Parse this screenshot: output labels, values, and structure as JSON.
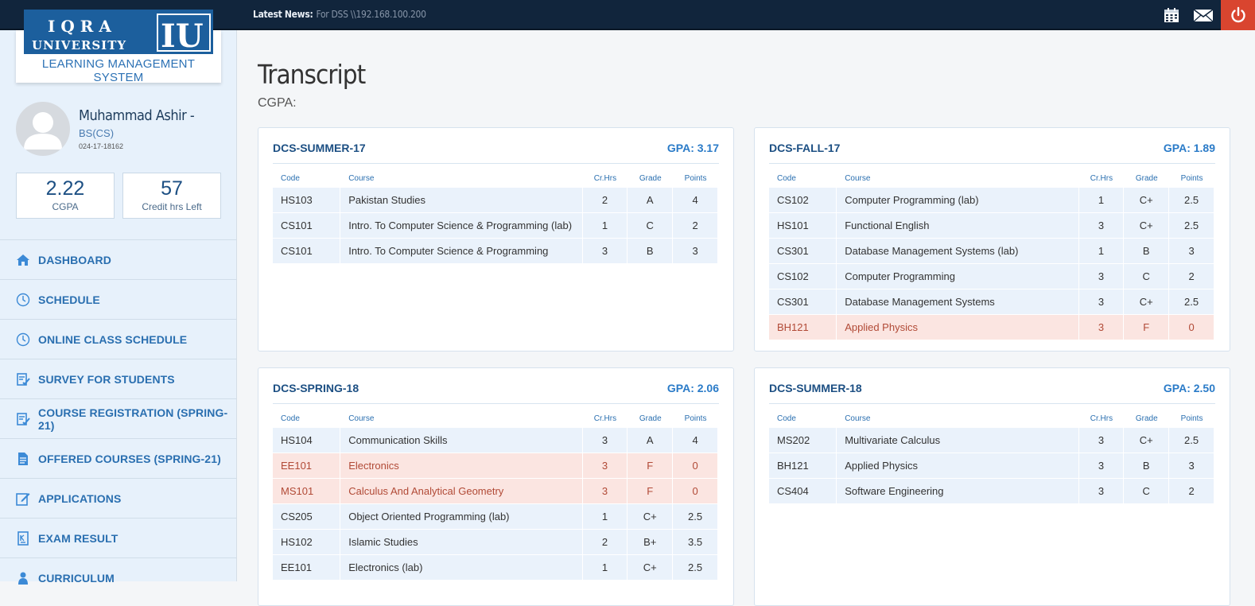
{
  "topbar": {
    "news_label": "Latest News:",
    "news_text": "For DSS \\\\192.168.100.200",
    "icons": [
      "calendar-icon",
      "mail-icon",
      "power-icon"
    ],
    "power_color": "#d9452f"
  },
  "logo": {
    "line1": "IQRA",
    "line2": "UNIVERSITY",
    "mark": "IU",
    "subtitle": "LEARNING MANAGEMENT SYSTEM",
    "brand_color": "#1c5f9d"
  },
  "profile": {
    "name": "Muhammad Ashir -",
    "program": "BS(CS)",
    "reg_no": "024-17-18162"
  },
  "stats": [
    {
      "value": "2.22",
      "label": "CGPA"
    },
    {
      "value": "57",
      "label": "Credit hrs Left"
    }
  ],
  "menu": [
    {
      "label": "DASHBOARD",
      "icon": "home-icon"
    },
    {
      "label": "SCHEDULE",
      "icon": "clock-icon"
    },
    {
      "label": "ONLINE CLASS SCHEDULE",
      "icon": "clock-icon"
    },
    {
      "label": "SURVEY FOR STUDENTS",
      "icon": "checklist-icon"
    },
    {
      "label": "COURSE REGISTRATION (SPRING-21)",
      "icon": "checklist-icon"
    },
    {
      "label": "OFFERED COURSES (SPRING-21)",
      "icon": "document-icon"
    },
    {
      "label": "APPLICATIONS",
      "icon": "edit-icon"
    },
    {
      "label": "EXAM RESULT",
      "icon": "result-icon"
    },
    {
      "label": "CURRICULUM",
      "icon": "person-icon"
    }
  ],
  "page": {
    "title": "Transcript",
    "cgpa_label": "CGPA:"
  },
  "table_headers": [
    "Code",
    "Course",
    "Cr.Hrs",
    "Grade",
    "Points"
  ],
  "semesters": [
    {
      "name": "DCS-SUMMER-17",
      "gpa": "GPA: 3.17",
      "rows": [
        {
          "code": "HS103",
          "course": "Pakistan Studies",
          "crhrs": "2",
          "grade": "A",
          "points": "4",
          "fail": false
        },
        {
          "code": "CS101",
          "course": "Intro. To Computer Science & Programming (lab)",
          "crhrs": "1",
          "grade": "C",
          "points": "2",
          "fail": false
        },
        {
          "code": "CS101",
          "course": "Intro. To Computer Science & Programming",
          "crhrs": "3",
          "grade": "B",
          "points": "3",
          "fail": false
        }
      ]
    },
    {
      "name": "DCS-FALL-17",
      "gpa": "GPA: 1.89",
      "rows": [
        {
          "code": "CS102",
          "course": "Computer Programming (lab)",
          "crhrs": "1",
          "grade": "C+",
          "points": "2.5",
          "fail": false
        },
        {
          "code": "HS101",
          "course": "Functional English",
          "crhrs": "3",
          "grade": "C+",
          "points": "2.5",
          "fail": false
        },
        {
          "code": "CS301",
          "course": "Database Management Systems (lab)",
          "crhrs": "1",
          "grade": "B",
          "points": "3",
          "fail": false
        },
        {
          "code": "CS102",
          "course": "Computer Programming",
          "crhrs": "3",
          "grade": "C",
          "points": "2",
          "fail": false
        },
        {
          "code": "CS301",
          "course": "Database Management Systems",
          "crhrs": "3",
          "grade": "C+",
          "points": "2.5",
          "fail": false
        },
        {
          "code": "BH121",
          "course": "Applied Physics",
          "crhrs": "3",
          "grade": "F",
          "points": "0",
          "fail": true
        }
      ]
    },
    {
      "name": "DCS-SPRING-18",
      "gpa": "GPA: 2.06",
      "rows": [
        {
          "code": "HS104",
          "course": "Communication Skills",
          "crhrs": "3",
          "grade": "A",
          "points": "4",
          "fail": false
        },
        {
          "code": "EE101",
          "course": "Electronics",
          "crhrs": "3",
          "grade": "F",
          "points": "0",
          "fail": true
        },
        {
          "code": "MS101",
          "course": "Calculus And Analytical Geometry",
          "crhrs": "3",
          "grade": "F",
          "points": "0",
          "fail": true
        },
        {
          "code": "CS205",
          "course": "Object Oriented Programming (lab)",
          "crhrs": "1",
          "grade": "C+",
          "points": "2.5",
          "fail": false
        },
        {
          "code": "HS102",
          "course": "Islamic Studies",
          "crhrs": "2",
          "grade": "B+",
          "points": "3.5",
          "fail": false
        },
        {
          "code": "EE101",
          "course": "Electronics (lab)",
          "crhrs": "1",
          "grade": "C+",
          "points": "2.5",
          "fail": false
        }
      ]
    },
    {
      "name": "DCS-SUMMER-18",
      "gpa": "GPA: 2.50",
      "rows": [
        {
          "code": "MS202",
          "course": "Multivariate Calculus",
          "crhrs": "3",
          "grade": "C+",
          "points": "2.5",
          "fail": false
        },
        {
          "code": "BH121",
          "course": "Applied Physics",
          "crhrs": "3",
          "grade": "B",
          "points": "3",
          "fail": false
        },
        {
          "code": "CS404",
          "course": "Software Engineering",
          "crhrs": "3",
          "grade": "C",
          "points": "2",
          "fail": false
        }
      ]
    }
  ]
}
